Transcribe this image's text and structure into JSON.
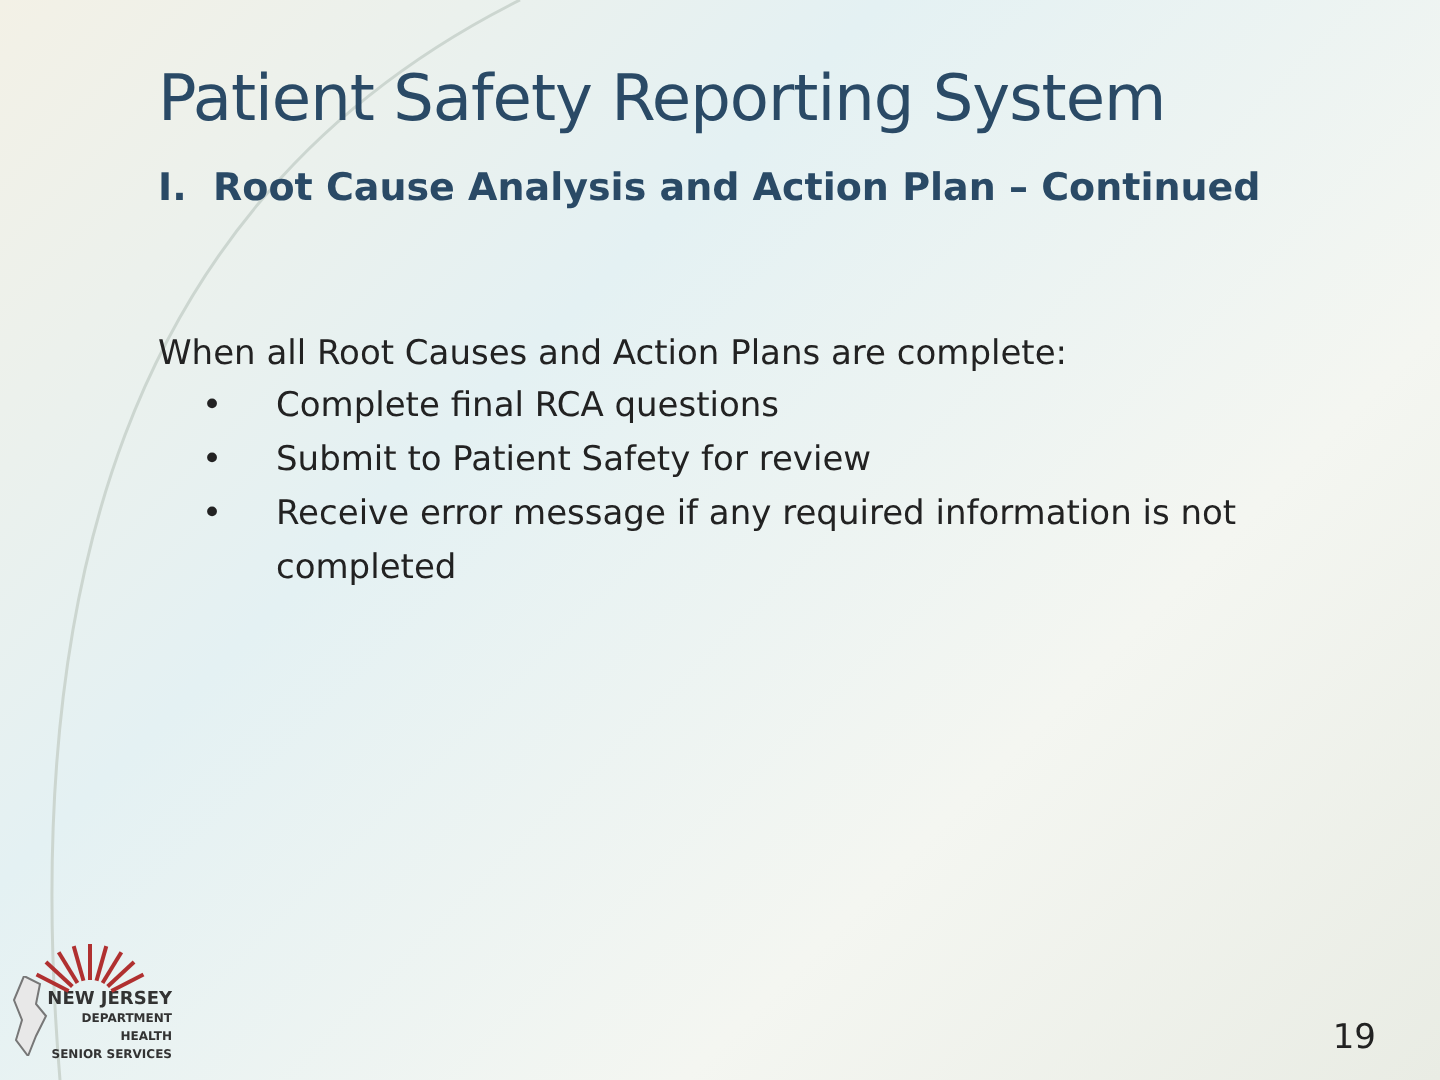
{
  "slide": {
    "title": "Patient Safety Reporting System",
    "subtitle": "I.  Root Cause Analysis and Action Plan – Continued",
    "intro": "When all Root Causes and Action Plans are complete:",
    "bullet_char": "•",
    "bullets": [
      "Complete final RCA questions",
      "Submit to Patient Safety for review",
      "Receive error message if any required information is not completed"
    ],
    "logo_lines": [
      "NEW JERSEY",
      "DEPARTMENT",
      "HEALTH",
      "SENIOR SERVICES"
    ],
    "page_number": "19"
  }
}
